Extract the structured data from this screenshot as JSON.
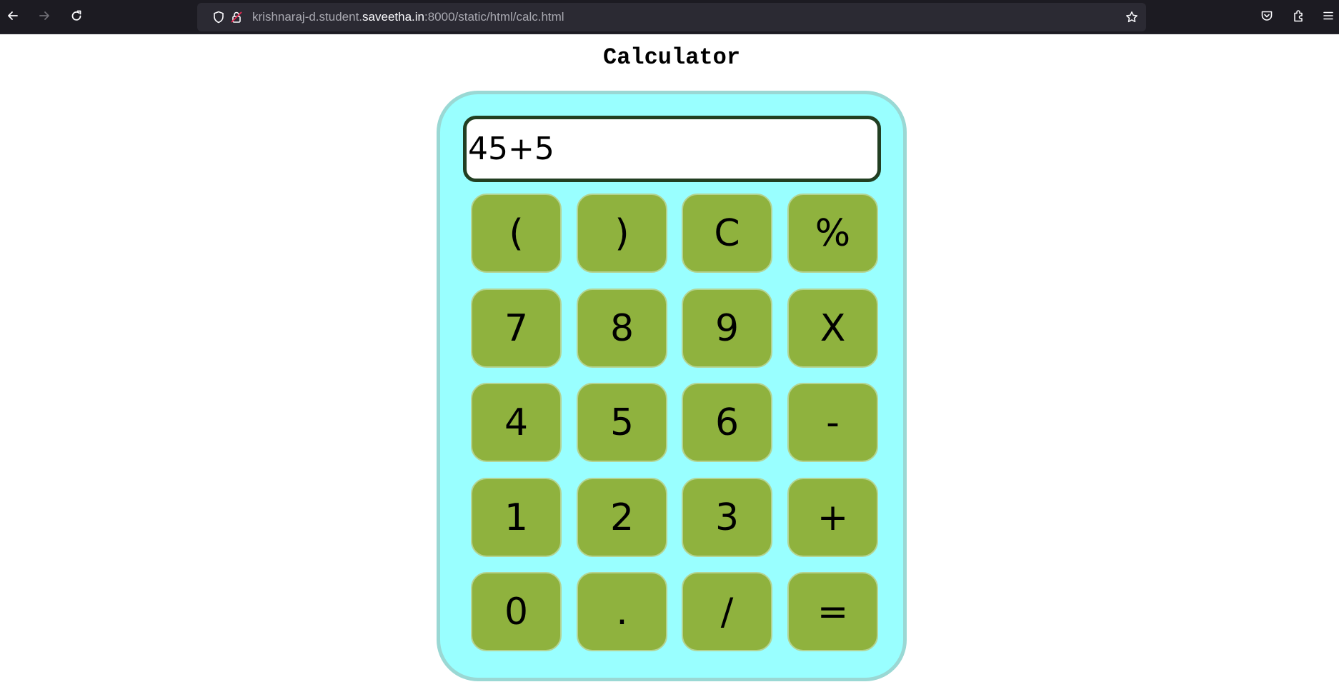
{
  "browser": {
    "url_prefix": "krishnaraj-d.student.",
    "url_host": "saveetha.in",
    "url_suffix": ":8000/static/html/calc.html",
    "icons": [
      "back-arrow-icon",
      "forward-arrow-icon",
      "reload-icon",
      "shield-icon",
      "insecure-lock-icon",
      "bookmark-star-icon",
      "pocket-icon",
      "extensions-icon",
      "menu-icon"
    ]
  },
  "page": {
    "title": "Calculator"
  },
  "calculator": {
    "display": "45+5",
    "keys": [
      {
        "label": "("
      },
      {
        "label": ")"
      },
      {
        "label": "C"
      },
      {
        "label": "%"
      },
      {
        "label": "7"
      },
      {
        "label": "8"
      },
      {
        "label": "9"
      },
      {
        "label": "X"
      },
      {
        "label": "4"
      },
      {
        "label": "5"
      },
      {
        "label": "6"
      },
      {
        "label": "-"
      },
      {
        "label": "1"
      },
      {
        "label": "2"
      },
      {
        "label": "3"
      },
      {
        "label": "+"
      },
      {
        "label": "0"
      },
      {
        "label": "."
      },
      {
        "label": "/"
      },
      {
        "label": "="
      }
    ]
  },
  "colors": {
    "body_bg": "#99ffff",
    "body_border": "#9ad8d4",
    "key_bg": "#8fb23e",
    "display_border": "#223f22",
    "browser_toolbar": "#1c1b22",
    "urlbar_bg": "#2b2a33"
  }
}
